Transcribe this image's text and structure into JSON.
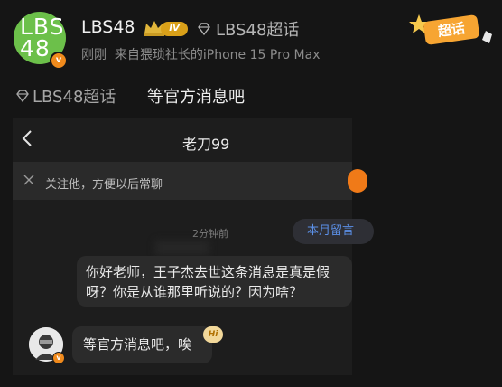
{
  "post": {
    "username": "LBS48",
    "avatar_text": "LBS\n48",
    "level_badge": "IV",
    "header_topic": "LBS48超话",
    "meta": "刚刚  来自猥琐社长的iPhone 15 Pro Max",
    "sticker_label": "超话",
    "topic_link": "LBS48超话",
    "body_text": "等官方消息吧"
  },
  "chat": {
    "title": "老刀99",
    "follow_hint": "关注他，方便以后常聊",
    "timestamp": "2分钟前",
    "month_pill": "本月留言",
    "incoming_message": "你好老师，王子杰去世这条消息是真是假呀？你是从谁那里听说的？因为啥？",
    "outgoing_message": "等官方消息吧，唉",
    "hi_sticker": "Hi"
  },
  "colors": {
    "background": "#151515",
    "chat_background": "#1d1d1d",
    "accent_green": "#6cc04a",
    "accent_orange": "#f08a1c",
    "link_blue": "#5b8fe6",
    "level_gold": "#d9a019"
  },
  "icons": [
    "crown-icon",
    "diamond-icon",
    "verified-icon",
    "back-arrow-icon",
    "close-icon"
  ]
}
